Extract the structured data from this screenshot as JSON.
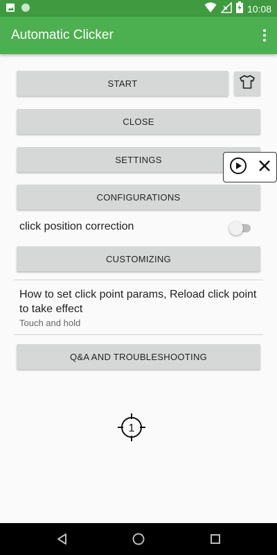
{
  "status_bar": {
    "time": "10:08",
    "icons_left": [
      "image-icon",
      "circle-app-icon"
    ],
    "icons_right": [
      "wifi-icon",
      "no-signal-icon",
      "battery-icon"
    ]
  },
  "app_bar": {
    "title": "Automatic Clicker",
    "overflow_icon": "more-vert-icon"
  },
  "buttons": {
    "start": "START",
    "close": "CLOSE",
    "settings": "SETTINGS",
    "configurations": "CONFIGURATIONS",
    "customizing": "CUSTOMIZING",
    "qa": "Q&A AND TROUBLESHOOTING"
  },
  "click_position_correction": {
    "label": "click position correction",
    "enabled": false
  },
  "preference": {
    "title": "How to set click point params, Reload click point to take effect",
    "summary": "Touch and hold"
  },
  "floating_panel": {
    "icons": [
      "play-circle-icon",
      "close-icon"
    ]
  },
  "click_target": {
    "number": "1"
  },
  "colors": {
    "status_bar": "#3f9a40",
    "app_bar": "#4caf50",
    "button_bg": "#d6d7d7"
  }
}
